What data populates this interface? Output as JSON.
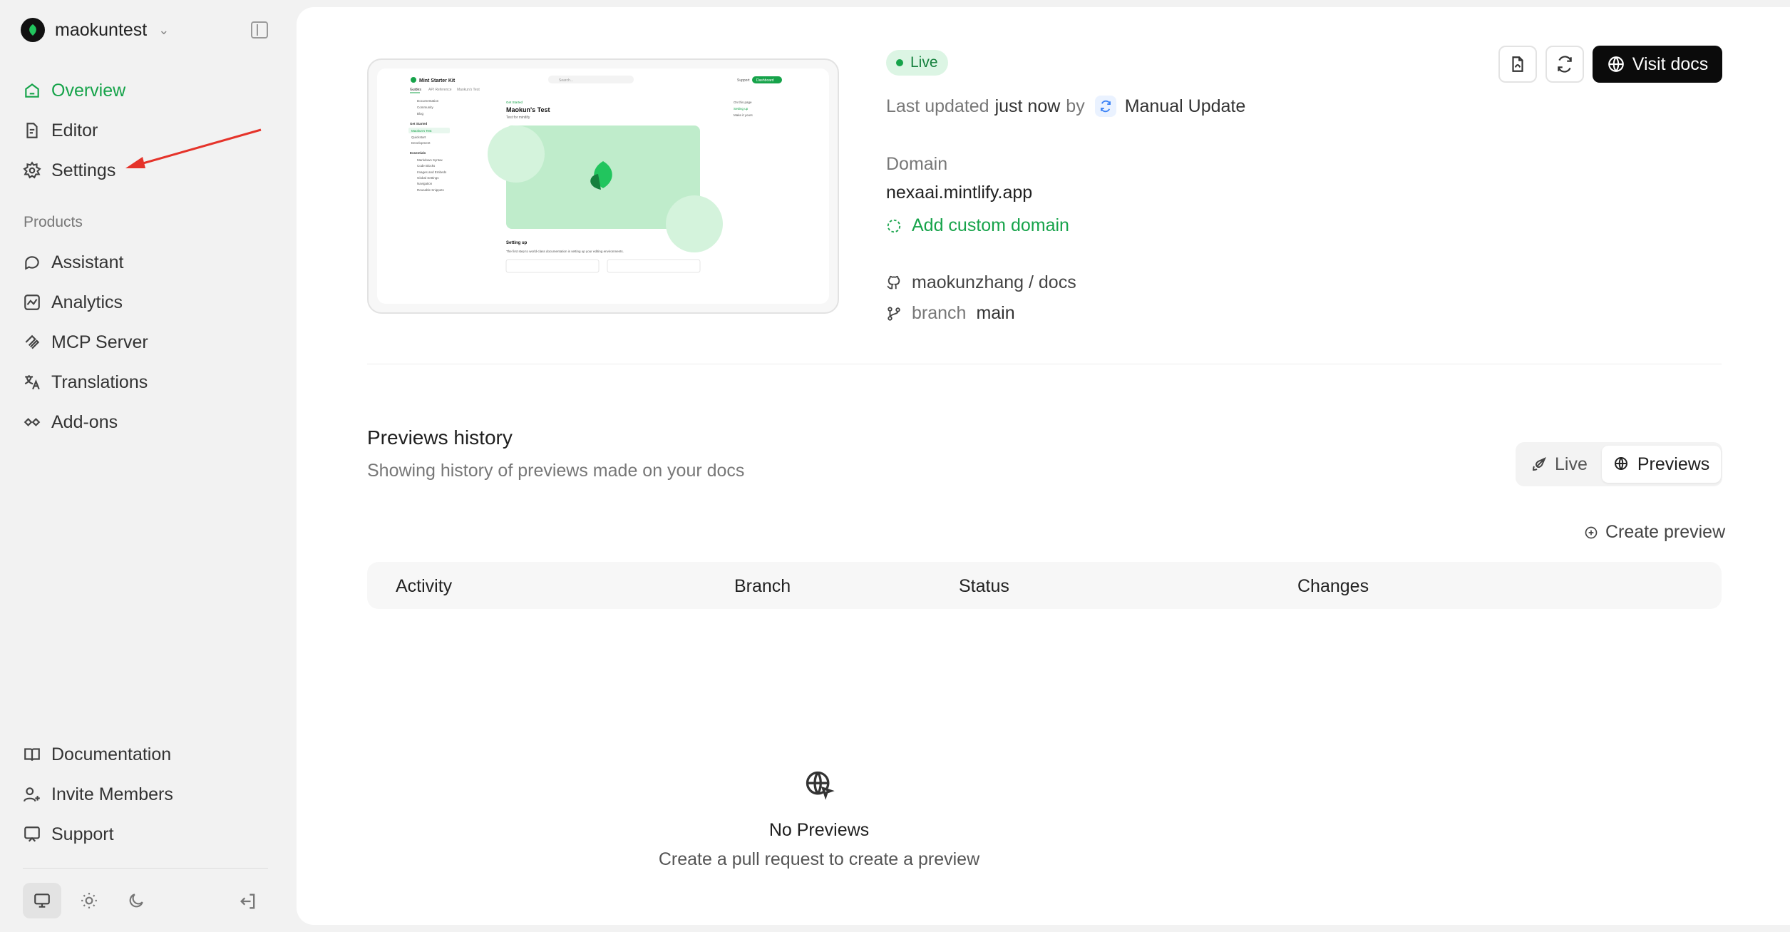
{
  "org": {
    "name": "maokuntest"
  },
  "nav": {
    "overview": "Overview",
    "editor": "Editor",
    "settings": "Settings",
    "products_title": "Products",
    "assistant": "Assistant",
    "analytics": "Analytics",
    "mcp": "MCP Server",
    "translations": "Translations",
    "addons": "Add-ons",
    "documentation": "Documentation",
    "invite": "Invite Members",
    "support": "Support"
  },
  "status": {
    "badge": "Live",
    "last_updated_label": "Last updated",
    "last_updated_value": "just now",
    "by": "by",
    "update_type": "Manual Update"
  },
  "domain": {
    "label": "Domain",
    "value": "nexaai.mintlify.app",
    "add_custom": "Add custom domain"
  },
  "repo": {
    "name": "maokunzhang / docs",
    "branch_label": "branch",
    "branch_value": "main"
  },
  "actions": {
    "visit_docs": "Visit docs"
  },
  "previews": {
    "title": "Previews history",
    "subtitle": "Showing history of previews made on your docs",
    "toggle_live": "Live",
    "toggle_previews": "Previews",
    "create": "Create preview",
    "columns": [
      "Activity",
      "Branch",
      "Status",
      "Changes"
    ],
    "empty_title": "No Previews",
    "empty_sub": "Create a pull request to create a preview"
  },
  "thumbnail": {
    "brand": "Mint Starter Kit",
    "search": "Search...",
    "tabs": [
      "Guides",
      "API Reference",
      "Maokun's Test"
    ],
    "support": "Support",
    "dashboard": "Dashboard",
    "side_links": [
      "Documentation",
      "Community",
      "Blog"
    ],
    "group1": "Get Started",
    "group1_items": [
      "Maokun's Test",
      "Quickstart",
      "Development"
    ],
    "group2": "Essentials",
    "group2_items": [
      "Markdown Syntax",
      "Code Blocks",
      "Images and Embeds",
      "Global Settings",
      "Navigation",
      "Reusable Snippets"
    ],
    "crumb": "Get Started",
    "page_title": "Maokun's Test",
    "page_sub": "Test for mintlify",
    "toc_title": "On this page",
    "toc_items": [
      "Setting up",
      "Make it yours"
    ],
    "section": "Setting up",
    "section_text": "The first step to world-class documentation is setting up your editing environments."
  },
  "colors": {
    "accent": "#16a34a",
    "badge_bg": "#dcf5e4",
    "primary_btn": "#0b0b0b"
  }
}
